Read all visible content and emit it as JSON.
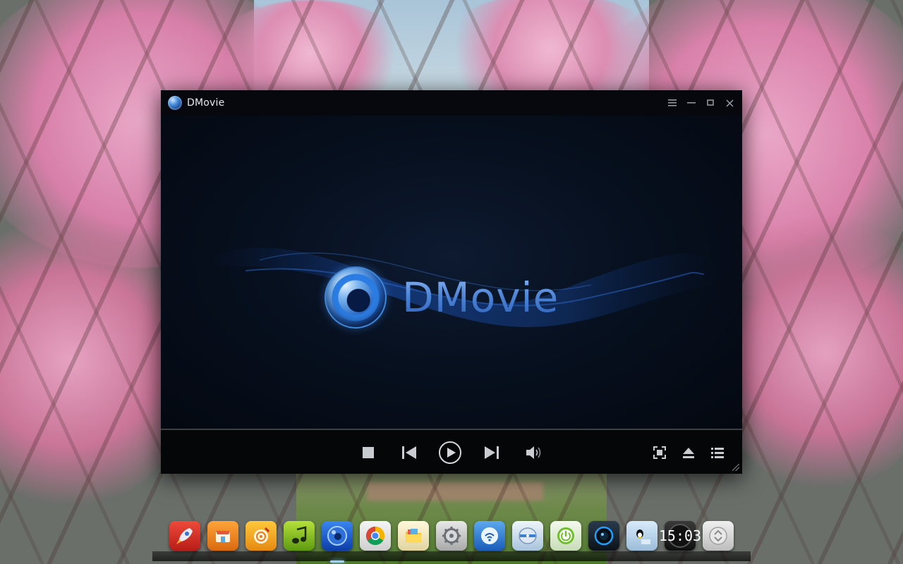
{
  "window": {
    "title": "DMovie",
    "controls": {
      "menu_icon": "menu-icon",
      "minimize_icon": "minimize-icon",
      "maximize_icon": "maximize-icon",
      "close_icon": "close-icon"
    }
  },
  "player": {
    "logo_text": "DMovie"
  },
  "controlbar": {
    "stop": "stop-icon",
    "previous": "previous-icon",
    "play": "play-icon",
    "next": "next-icon",
    "volume": "volume-icon",
    "fullscreen": "fullscreen-icon",
    "eject": "eject-icon",
    "playlist": "playlist-icon"
  },
  "dock": {
    "items": [
      {
        "name": "launcher",
        "icon": "rocket-icon",
        "color": "#d8302a"
      },
      {
        "name": "store",
        "icon": "store-icon",
        "color": "#f08a1a"
      },
      {
        "name": "music-player",
        "icon": "music-icon",
        "color": "#f0a418"
      },
      {
        "name": "music-app",
        "icon": "music-note-icon",
        "color": "#8cc21a"
      },
      {
        "name": "dmovie",
        "icon": "dmovie-icon",
        "color": "#1c64d8"
      },
      {
        "name": "chrome",
        "icon": "chrome-icon",
        "color": "#e9e9e9"
      },
      {
        "name": "file-manager",
        "icon": "folder-icon",
        "color": "#f1e8c4"
      },
      {
        "name": "settings",
        "icon": "gear-icon",
        "color": "#cfcfcf"
      },
      {
        "name": "network",
        "icon": "network-icon",
        "color": "#3a8fe0"
      },
      {
        "name": "disk",
        "icon": "disk-icon",
        "color": "#c9dcee"
      },
      {
        "name": "power",
        "icon": "power-icon",
        "color": "#e8f0e0"
      },
      {
        "name": "camera",
        "icon": "camera-icon",
        "color": "#1a2a3a"
      },
      {
        "name": "qq",
        "icon": "penguin-icon",
        "color": "#b8d4ec"
      },
      {
        "name": "clock",
        "icon": "clock-icon",
        "color": "#222222"
      },
      {
        "name": "trash",
        "icon": "trash-icon",
        "color": "#dcdcdc"
      }
    ],
    "clock_time": "15:03"
  }
}
